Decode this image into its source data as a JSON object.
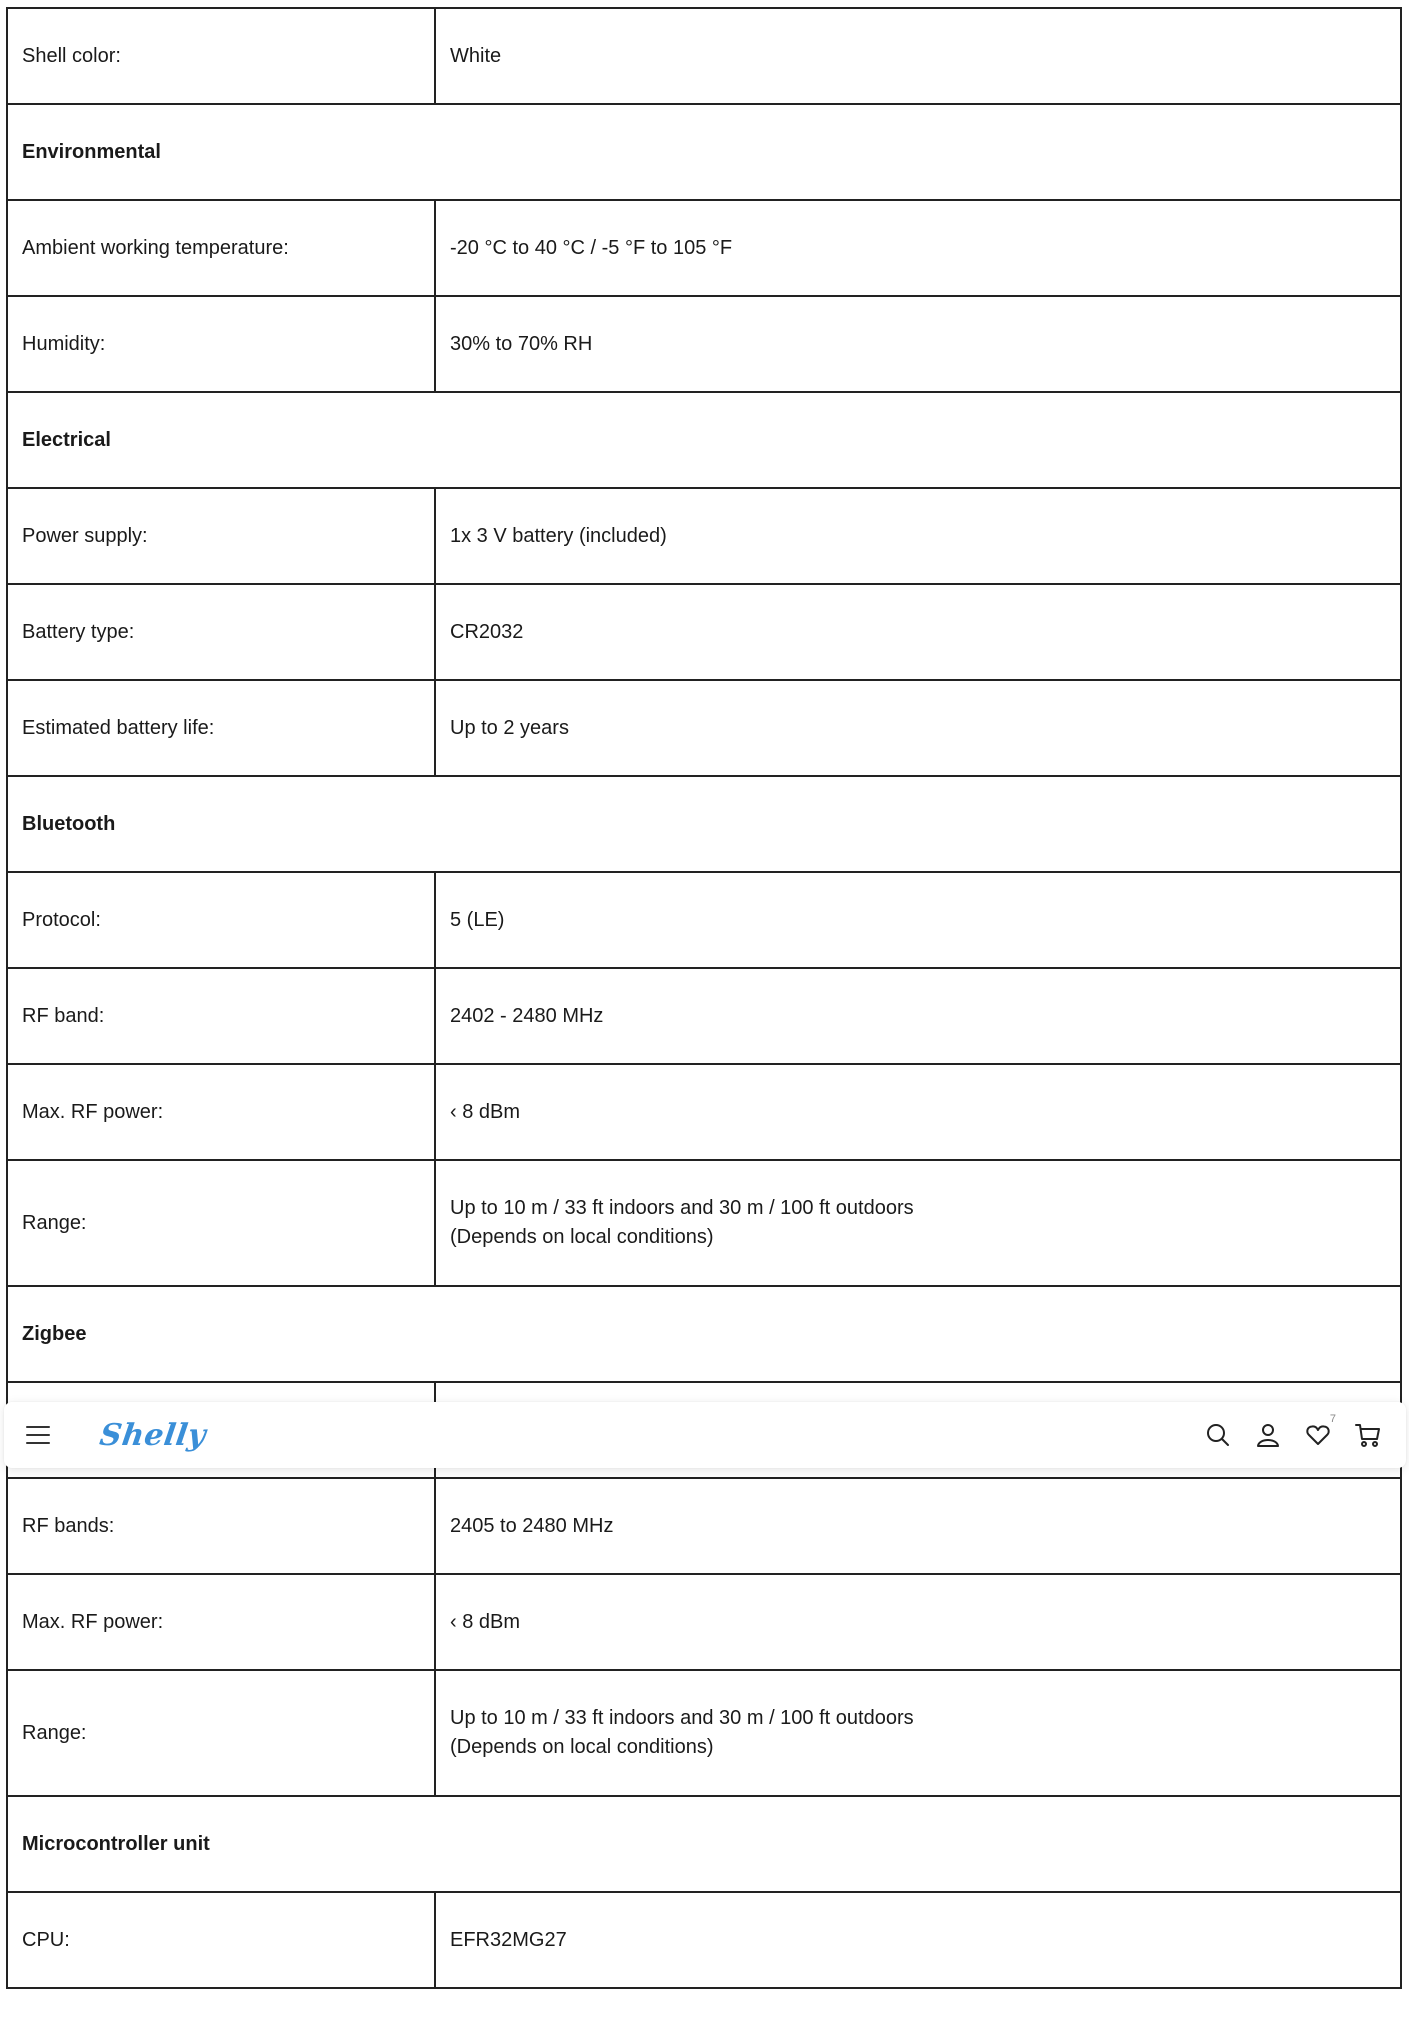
{
  "spec_rows": [
    {
      "kind": "pair",
      "label": "Shell color:",
      "value": [
        "White"
      ]
    },
    {
      "kind": "section",
      "label": "Environmental"
    },
    {
      "kind": "pair",
      "label": "Ambient working temperature:",
      "value": [
        "-20 °C to 40 °C / -5 °F to 105 °F"
      ]
    },
    {
      "kind": "pair",
      "label": "Humidity:",
      "value": [
        "30% to 70% RH"
      ]
    },
    {
      "kind": "section",
      "label": "Electrical"
    },
    {
      "kind": "pair",
      "label": "Power supply:",
      "value": [
        "1x 3 V battery (included)"
      ]
    },
    {
      "kind": "pair",
      "label": "Battery type:",
      "value": [
        "CR2032"
      ]
    },
    {
      "kind": "pair",
      "label": "Estimated battery life:",
      "value": [
        "Up to 2 years"
      ]
    },
    {
      "kind": "section",
      "label": "Bluetooth"
    },
    {
      "kind": "pair",
      "label": "Protocol:",
      "value": [
        "5 (LE)"
      ]
    },
    {
      "kind": "pair",
      "label": "RF band:",
      "value": [
        "2402 - 2480 MHz"
      ]
    },
    {
      "kind": "pair",
      "label": "Max. RF power:",
      "value": [
        "‹ 8 dBm"
      ]
    },
    {
      "kind": "pair",
      "label": "Range:",
      "value": [
        "Up to 10 m / 33 ft indoors and 30 m / 100 ft outdoors",
        "(Depends on local conditions)"
      ]
    },
    {
      "kind": "section",
      "label": "Zigbee"
    },
    {
      "kind": "pair",
      "label": "",
      "value": [
        ""
      ]
    },
    {
      "kind": "pair",
      "label": "RF bands:",
      "value": [
        "2405 to 2480 MHz"
      ]
    },
    {
      "kind": "pair",
      "label": "Max. RF power:",
      "value": [
        "‹ 8 dBm"
      ]
    },
    {
      "kind": "pair",
      "label": "Range:",
      "value": [
        "Up to 10 m / 33 ft indoors and 30 m / 100 ft outdoors",
        "(Depends on local conditions)"
      ]
    },
    {
      "kind": "section",
      "label": "Microcontroller unit"
    },
    {
      "kind": "pair",
      "label": "CPU:",
      "value": [
        "EFR32MG27"
      ]
    }
  ],
  "header": {
    "logo_text": "Shelly",
    "wishlist_count": "7",
    "icons": [
      "menu-icon",
      "search-icon",
      "user-icon",
      "heart-icon",
      "cart-icon"
    ]
  }
}
